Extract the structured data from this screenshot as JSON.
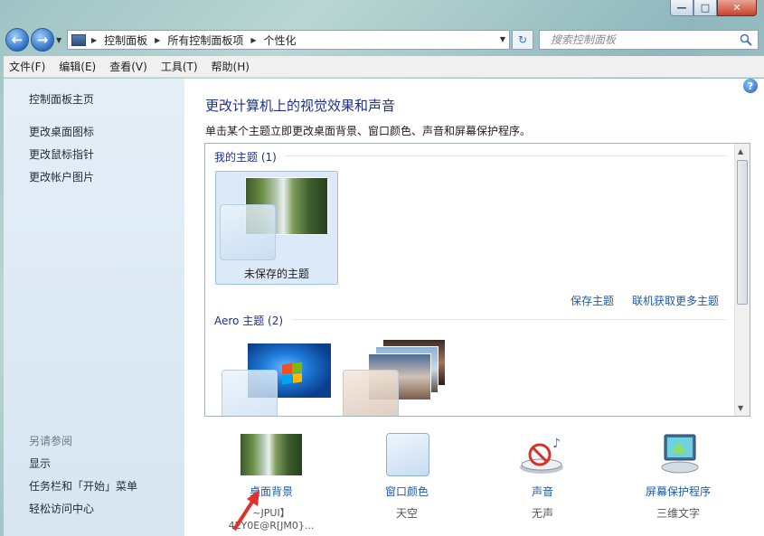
{
  "window": {
    "controls": [
      "—",
      "□",
      "✕"
    ]
  },
  "navigation": {
    "breadcrumbs": [
      "控制面板",
      "所有控制面板项",
      "个性化"
    ],
    "search_placeholder": "搜索控制面板"
  },
  "menu": [
    "文件(F)",
    "编辑(E)",
    "查看(V)",
    "工具(T)",
    "帮助(H)"
  ],
  "left_pane": {
    "home": "控制面板主页",
    "links": [
      "更改桌面图标",
      "更改鼠标指针",
      "更改帐户图片"
    ],
    "see_also_heading": "另请参阅",
    "see_also": [
      "显示",
      "任务栏和「开始」菜单",
      "轻松访问中心"
    ]
  },
  "main": {
    "title": "更改计算机上的视觉效果和声音",
    "description": "单击某个主题立即更改桌面背景、窗口颜色、声音和屏幕保护程序。",
    "my_themes_label": "我的主题 (1)",
    "unsaved_theme": "未保存的主题",
    "save_theme_link": "保存主题",
    "get_more_link": "联机获取更多主题",
    "aero_label": "Aero 主题 (2)"
  },
  "settings": [
    {
      "label": "桌面背景",
      "value": "~JPUI】4EY0E@R[JM0}..."
    },
    {
      "label": "窗口颜色",
      "value": "天空"
    },
    {
      "label": "声音",
      "value": "无声"
    },
    {
      "label": "屏幕保护程序",
      "value": "三维文字"
    }
  ],
  "colors": {
    "link": "#1e5aa8",
    "title": "#1e3287",
    "selection": "#dce9f8",
    "arrow": "#e0302a"
  }
}
